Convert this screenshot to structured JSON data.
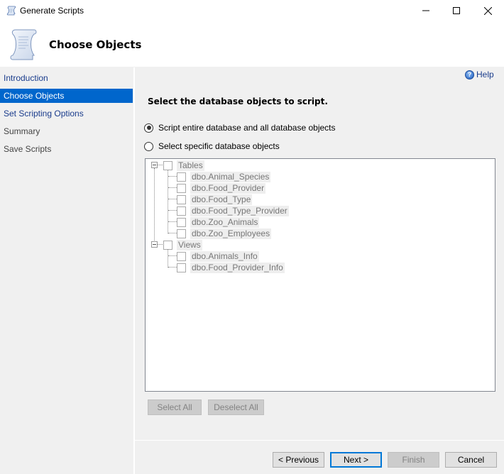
{
  "window": {
    "title": "Generate Scripts",
    "icon": "scroll-icon",
    "controls": [
      "minimize-icon",
      "maximize-icon",
      "close-icon"
    ]
  },
  "header": {
    "title": "Choose Objects",
    "icon": "scroll-icon"
  },
  "sidebar": {
    "items": [
      {
        "label": "Introduction",
        "state": "link"
      },
      {
        "label": "Choose Objects",
        "state": "active"
      },
      {
        "label": "Set Scripting Options",
        "state": "link"
      },
      {
        "label": "Summary",
        "state": "disabled"
      },
      {
        "label": "Save Scripts",
        "state": "disabled"
      }
    ]
  },
  "help": {
    "label": "Help",
    "icon": "help-icon"
  },
  "main": {
    "section_title": "Select the database objects to script.",
    "options": [
      {
        "label": "Script entire database and all database objects",
        "checked": true
      },
      {
        "label": "Select specific database objects",
        "checked": false
      }
    ],
    "tree": [
      {
        "label": "Tables",
        "expanded": true,
        "checked": false,
        "children": [
          {
            "label": "dbo.Animal_Species",
            "checked": false
          },
          {
            "label": "dbo.Food_Provider",
            "checked": false
          },
          {
            "label": "dbo.Food_Type",
            "checked": false
          },
          {
            "label": "dbo.Food_Type_Provider",
            "checked": false
          },
          {
            "label": "dbo.Zoo_Animals",
            "checked": false
          },
          {
            "label": "dbo.Zoo_Employees",
            "checked": false
          }
        ]
      },
      {
        "label": "Views",
        "expanded": true,
        "checked": false,
        "children": [
          {
            "label": "dbo.Animals_Info",
            "checked": false
          },
          {
            "label": "dbo.Food_Provider_Info",
            "checked": false
          }
        ]
      }
    ],
    "select_all_label": "Select All",
    "deselect_all_label": "Deselect All"
  },
  "footer": {
    "previous_label": "< Previous",
    "next_label": "Next >",
    "finish_label": "Finish",
    "cancel_label": "Cancel"
  },
  "colors": {
    "accent": "#0066cc",
    "link": "#1a3c8c",
    "background": "#f0f0f0",
    "default_button_border": "#0078d7"
  }
}
